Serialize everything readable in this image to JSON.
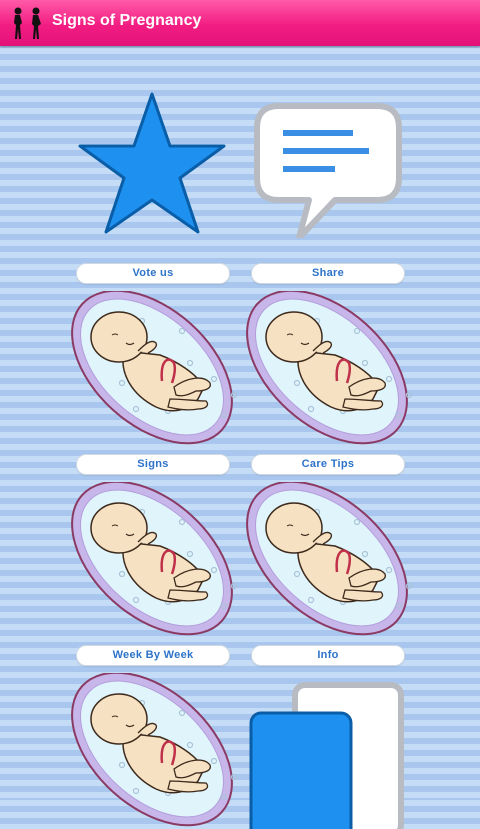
{
  "app": {
    "title": "Signs of Pregnancy",
    "icon": "pregnant-women-logo-icon"
  },
  "colors": {
    "topbar": "#f21d82",
    "label_text": "#2d73c9",
    "star": "#1e90f0"
  },
  "tiles": [
    {
      "label": "Vote us",
      "icon": "star-icon"
    },
    {
      "label": "Share",
      "icon": "speech-bubble-icon"
    },
    {
      "label": "Signs",
      "icon": "fetus-icon"
    },
    {
      "label": "Care Tips",
      "icon": "fetus-icon"
    },
    {
      "label": "Week By Week",
      "icon": "fetus-icon"
    },
    {
      "label": "Info",
      "icon": "fetus-icon"
    },
    {
      "label": "",
      "icon": "fetus-icon"
    },
    {
      "label": "",
      "icon": "copy-pages-icon"
    }
  ]
}
